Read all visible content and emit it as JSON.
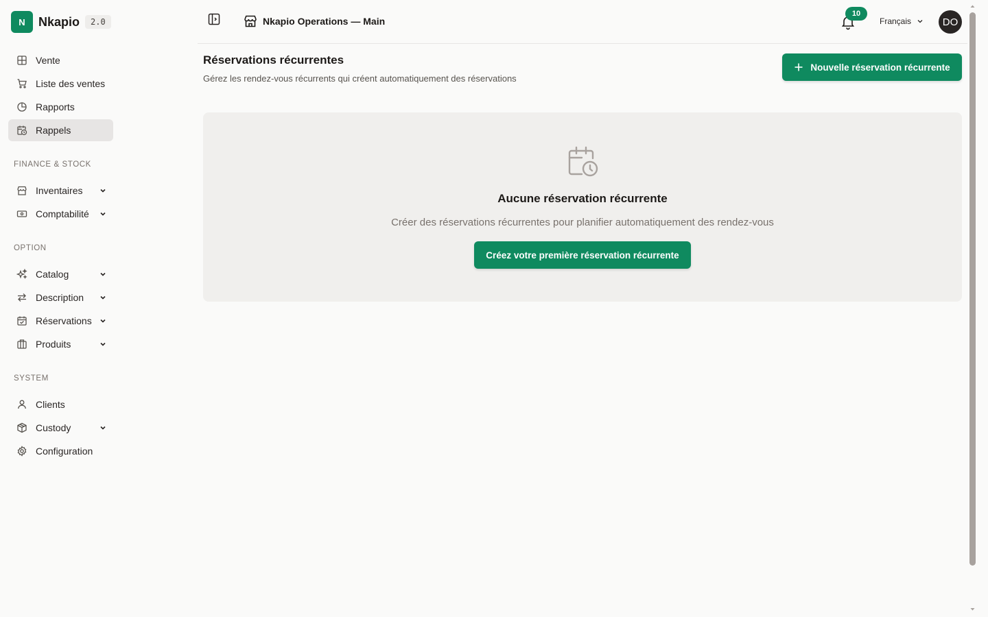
{
  "brand": {
    "logo_letter": "N",
    "name": "Nkapio",
    "version": "2.0"
  },
  "sidebar": {
    "main": [
      {
        "label": "Vente",
        "icon": "grid-icon"
      },
      {
        "label": "Liste des ventes",
        "icon": "cart-icon"
      },
      {
        "label": "Rapports",
        "icon": "pie-chart-icon"
      },
      {
        "label": "Rappels",
        "icon": "calendar-clock-icon",
        "active": true
      }
    ],
    "finance_title": "FINANCE & STOCK",
    "finance": [
      {
        "label": "Inventaires",
        "icon": "store-icon",
        "expandable": true
      },
      {
        "label": "Comptabilité",
        "icon": "banknote-icon",
        "expandable": true
      }
    ],
    "option_title": "OPTION",
    "option": [
      {
        "label": "Catalog",
        "icon": "sparkles-icon",
        "expandable": true
      },
      {
        "label": "Description",
        "icon": "arrows-swap-icon",
        "expandable": true
      },
      {
        "label": "Réservations",
        "icon": "calendar-check-icon",
        "expandable": true
      },
      {
        "label": "Produits",
        "icon": "columns-icon",
        "expandable": true
      }
    ],
    "system_title": "SYSTEM",
    "system": [
      {
        "label": "Clients",
        "icon": "user-icon"
      },
      {
        "label": "Custody",
        "icon": "package-icon",
        "expandable": true
      },
      {
        "label": "Configuration",
        "icon": "gear-icon"
      }
    ]
  },
  "topbar": {
    "store_name": "Nkapio Operations — Main",
    "notifications_count": "10",
    "language": "Français",
    "avatar_initials": "DO"
  },
  "main": {
    "title": "Réservations récurrentes",
    "subtitle": "Gérez les rendez-vous récurrents qui créent automatiquement des réservations",
    "new_button_label": "Nouvelle réservation récurrente",
    "empty_state": {
      "title": "Aucune réservation récurrente",
      "text": "Créer des réservations récurrentes pour planifier automatiquement des rendez-vous",
      "button_label": "Créez votre première réservation récurrente"
    }
  },
  "colors": {
    "accent": "#0f8a5f",
    "background": "#fafaf9",
    "card": "#f0efed",
    "active_item": "#e7e5e4"
  }
}
